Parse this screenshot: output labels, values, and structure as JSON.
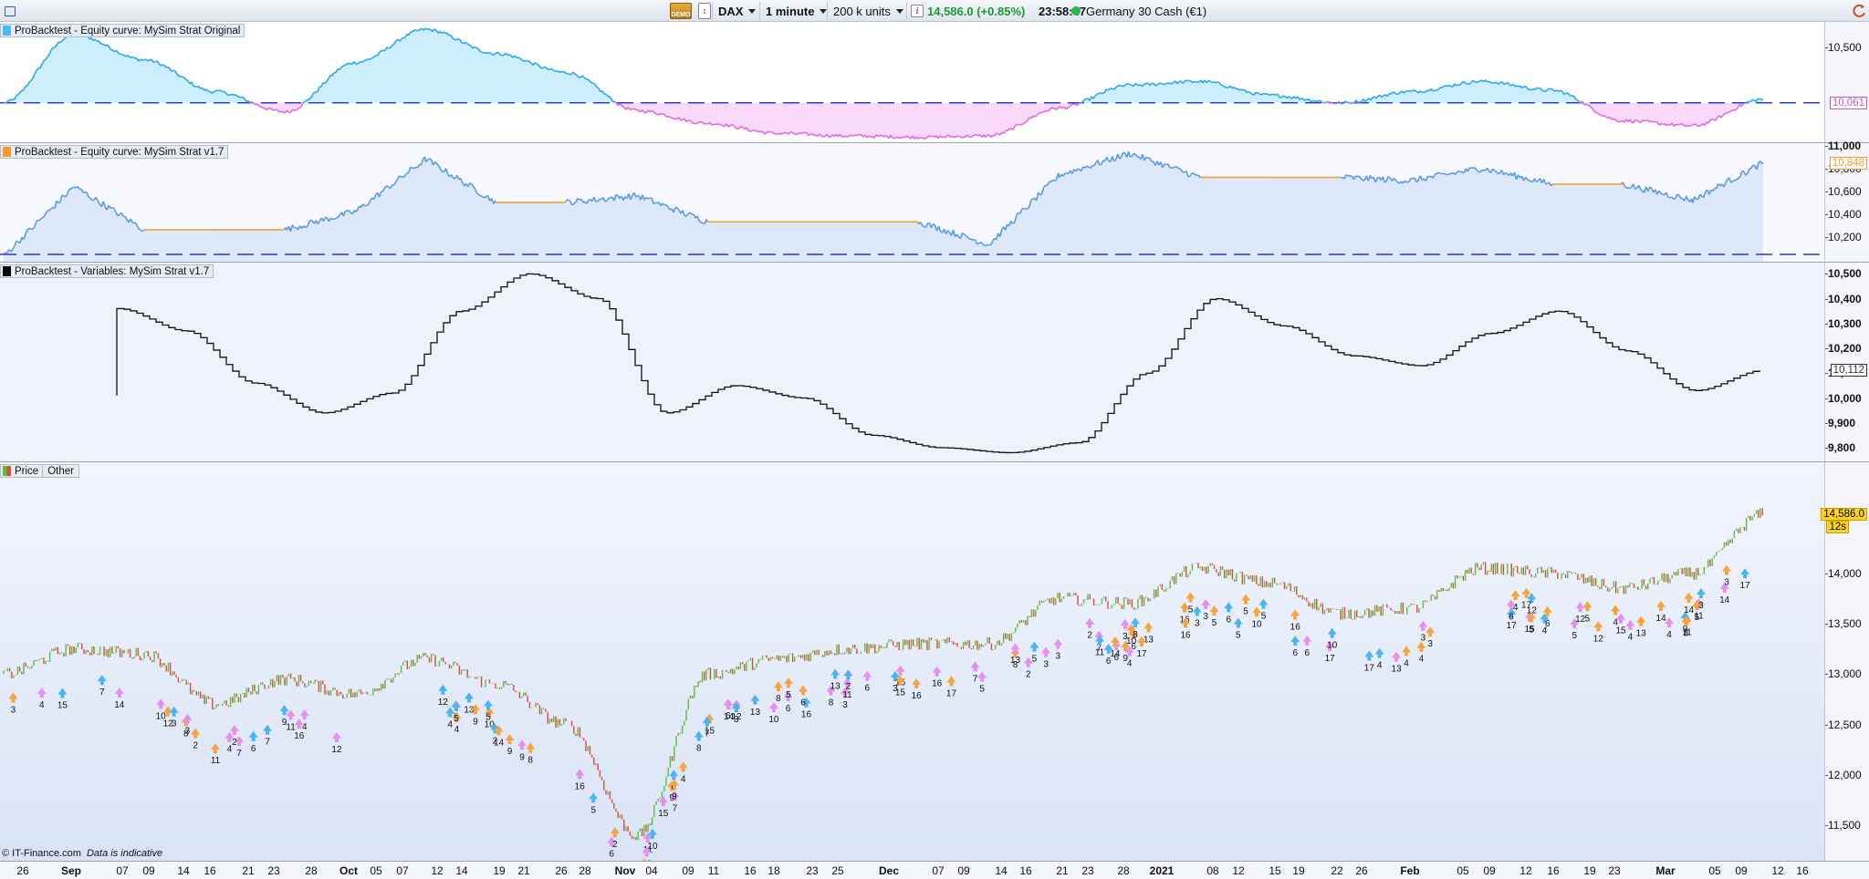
{
  "toolbar": {
    "demo_label": "DEMO",
    "instrument": "DAX",
    "timeframe": "1 minute",
    "units": "200 k units",
    "last_price": "14,586.0 (+0.85%)",
    "time": "23:58:47",
    "market": "Germany 30 Cash (€1)",
    "icons": [
      "window-icon",
      "demo-icon",
      "compare-icon",
      "info-icon",
      "refresh-icon"
    ]
  },
  "panels": {
    "equity_original": {
      "label": "ProBacktest - Equity curve: MySim Strat Original",
      "swatch": "#4db8ff",
      "y_ticks": [
        "10,500"
      ],
      "value_tag": "10,061",
      "baseline": 10061,
      "ylim": [
        9750,
        10700
      ],
      "color_above": "#29a8f2",
      "color_below": "#e06be0"
    },
    "equity_v17": {
      "label": "ProBacktest - Equity curve: MySim Strat v1.7",
      "swatch": "#f39c2c",
      "y_ticks": [
        "11,000",
        "10,800",
        "10,600",
        "10,400",
        "10,200"
      ],
      "value_tag": "10,848",
      "ylim": [
        9980,
        11020
      ],
      "color_in_market": "#5a9ae8",
      "color_flat": "#f39c2c"
    },
    "variables": {
      "label": "ProBacktest - Variables: MySim Strat v1.7",
      "swatch": "#000000",
      "y_ticks": [
        "10,500",
        "10,400",
        "10,300",
        "10,200",
        "10,100",
        "10,000",
        "9,900",
        "9,800"
      ],
      "value_tag": "10,112",
      "ylim": [
        9745,
        10545
      ]
    },
    "price": {
      "label_price": "Price",
      "label_other": "Other",
      "y_ticks": [
        "14,000",
        "13,500",
        "13,000",
        "12,500",
        "12,000",
        "11,500"
      ],
      "value_tag": "14,586.0",
      "countdown": "12s",
      "ylim": [
        11150,
        15100
      ],
      "color_up": "#52c43a",
      "color_down": "#e04848",
      "marker_colors": [
        "#e690ee",
        "#f4a53d",
        "#4cb4f2"
      ]
    }
  },
  "x_axis": {
    "labels": [
      {
        "t": "26",
        "b": false
      },
      {
        "t": "Sep",
        "b": true
      },
      {
        "t": "07",
        "b": false
      },
      {
        "t": "09",
        "b": false
      },
      {
        "t": "14",
        "b": false
      },
      {
        "t": "16",
        "b": false
      },
      {
        "t": "21",
        "b": false
      },
      {
        "t": "23",
        "b": false
      },
      {
        "t": "28",
        "b": false
      },
      {
        "t": "Oct",
        "b": true
      },
      {
        "t": "05",
        "b": false
      },
      {
        "t": "07",
        "b": false
      },
      {
        "t": "12",
        "b": false
      },
      {
        "t": "14",
        "b": false
      },
      {
        "t": "19",
        "b": false
      },
      {
        "t": "21",
        "b": false
      },
      {
        "t": "26",
        "b": false
      },
      {
        "t": "28",
        "b": false
      },
      {
        "t": "Nov",
        "b": true
      },
      {
        "t": "04",
        "b": false
      },
      {
        "t": "09",
        "b": false
      },
      {
        "t": "11",
        "b": false
      },
      {
        "t": "16",
        "b": false
      },
      {
        "t": "18",
        "b": false
      },
      {
        "t": "23",
        "b": false
      },
      {
        "t": "25",
        "b": false
      },
      {
        "t": "Dec",
        "b": true
      },
      {
        "t": "07",
        "b": false
      },
      {
        "t": "09",
        "b": false
      },
      {
        "t": "14",
        "b": false
      },
      {
        "t": "16",
        "b": false
      },
      {
        "t": "21",
        "b": false
      },
      {
        "t": "23",
        "b": false
      },
      {
        "t": "28",
        "b": false
      },
      {
        "t": "2021",
        "b": true
      },
      {
        "t": "08",
        "b": false
      },
      {
        "t": "12",
        "b": false
      },
      {
        "t": "15",
        "b": false
      },
      {
        "t": "19",
        "b": false
      },
      {
        "t": "22",
        "b": false
      },
      {
        "t": "26",
        "b": false
      },
      {
        "t": "Feb",
        "b": true
      },
      {
        "t": "05",
        "b": false
      },
      {
        "t": "09",
        "b": false
      },
      {
        "t": "12",
        "b": false
      },
      {
        "t": "16",
        "b": false
      },
      {
        "t": "19",
        "b": false
      },
      {
        "t": "23",
        "b": false
      },
      {
        "t": "Mar",
        "b": true
      },
      {
        "t": "05",
        "b": false
      },
      {
        "t": "09",
        "b": false
      },
      {
        "t": "12",
        "b": false
      },
      {
        "t": "16",
        "b": false
      }
    ]
  },
  "footer": {
    "copyright": "© IT-Finance.com",
    "indicative": "Data is indicative"
  },
  "chart_data": [
    {
      "type": "area",
      "title": "ProBacktest - Equity curve: MySim Strat Original",
      "note": "equity vs. starting baseline 10,061",
      "x": [
        "Aug 26",
        "Sep 07",
        "Sep 14",
        "Sep 21",
        "Sep 28",
        "Oct 05",
        "Oct 12",
        "Oct 19",
        "Oct 26",
        "Nov 04",
        "Nov 11",
        "Nov 18",
        "Nov 25",
        "Dec 07",
        "Dec 14",
        "Dec 21",
        "Dec 28",
        "Jan 08",
        "Jan 15",
        "Jan 22",
        "Feb 01",
        "Feb 09",
        "Feb 16",
        "Feb 23",
        "Mar 05",
        "Mar 12"
      ],
      "values": [
        10061,
        10600,
        10400,
        10150,
        9990,
        10380,
        10640,
        10450,
        10300,
        10000,
        9900,
        9820,
        9800,
        9790,
        9800,
        10020,
        10200,
        10230,
        10120,
        10060,
        10150,
        10230,
        10160,
        9920,
        9880,
        10090
      ],
      "ylim": [
        9750,
        10700
      ]
    },
    {
      "type": "line",
      "title": "ProBacktest - Equity curve: MySim Strat v1.7",
      "x": [
        "Aug 26",
        "Sep 07",
        "Sep 14",
        "Sep 21",
        "Sep 28",
        "Oct 05",
        "Oct 12",
        "Oct 19",
        "Oct 26",
        "Nov 04",
        "Nov 11",
        "Nov 18",
        "Nov 25",
        "Dec 07",
        "Dec 14",
        "Dec 21",
        "Dec 28",
        "Jan 08",
        "Jan 15",
        "Jan 22",
        "Feb 01",
        "Feb 09",
        "Feb 16",
        "Feb 23",
        "Mar 05",
        "Mar 12"
      ],
      "values": [
        10030,
        10640,
        10260,
        10260,
        10260,
        10420,
        10880,
        10500,
        10500,
        10560,
        10330,
        10330,
        10330,
        10330,
        10130,
        10740,
        10930,
        10720,
        10720,
        10720,
        10690,
        10800,
        10660,
        10660,
        10520,
        10848
      ],
      "ylim": [
        9980,
        11020
      ]
    },
    {
      "type": "line",
      "title": "ProBacktest - Variables: MySim Strat v1.7",
      "x": [
        "Sep 07",
        "Sep 14",
        "Sep 21",
        "Sep 28",
        "Oct 05",
        "Oct 12",
        "Oct 19",
        "Oct 26",
        "Nov 04",
        "Nov 11",
        "Nov 18",
        "Nov 25",
        "Dec 07",
        "Dec 14",
        "Dec 21",
        "Dec 28",
        "Jan 08",
        "Jan 15",
        "Jan 22",
        "Feb 01",
        "Feb 09",
        "Feb 16",
        "Feb 23",
        "Mar 05",
        "Mar 12"
      ],
      "values": [
        10360,
        10270,
        10060,
        9940,
        10020,
        10350,
        10500,
        10400,
        9940,
        10050,
        10000,
        9850,
        9800,
        9780,
        9820,
        10100,
        10400,
        10290,
        10170,
        10130,
        10260,
        10350,
        10190,
        10030,
        10112
      ],
      "ylim": [
        9745,
        10545
      ]
    },
    {
      "type": "line",
      "title": "Price",
      "x": [
        "Aug 26",
        "Sep 07",
        "Sep 14",
        "Sep 21",
        "Sep 28",
        "Oct 05",
        "Oct 12",
        "Oct 19",
        "Oct 26",
        "Nov 02",
        "Nov 09",
        "Nov 16",
        "Nov 25",
        "Dec 07",
        "Dec 14",
        "Dec 21",
        "Dec 28",
        "Jan 08",
        "Jan 15",
        "Jan 22",
        "Feb 01",
        "Feb 09",
        "Feb 16",
        "Feb 23",
        "Mar 05",
        "Mar 12"
      ],
      "values": [
        13000,
        13250,
        13200,
        12700,
        12950,
        12800,
        13150,
        12900,
        12500,
        11400,
        13000,
        13150,
        13250,
        13300,
        13300,
        13750,
        13700,
        14050,
        13900,
        13600,
        13650,
        14050,
        14000,
        13850,
        14000,
        14586
      ],
      "ylim": [
        11150,
        15100
      ]
    }
  ]
}
